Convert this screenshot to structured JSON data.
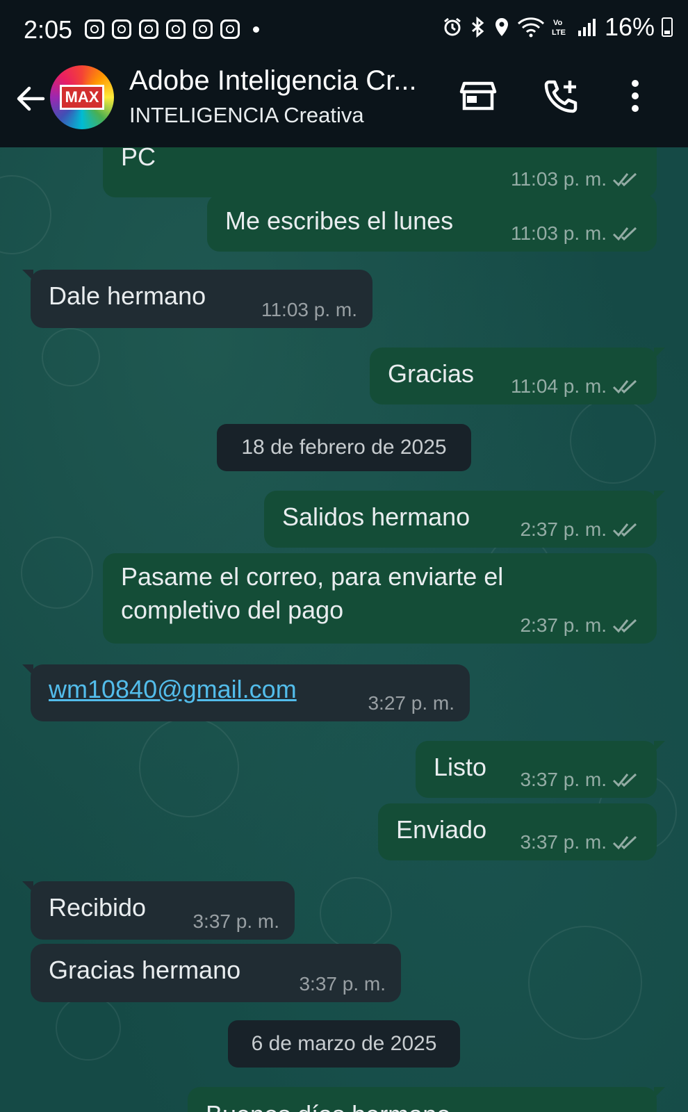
{
  "status_bar": {
    "time": "2:05",
    "battery": "16%"
  },
  "header": {
    "title": "Adobe Inteligencia Cr...",
    "subtitle": "INTELIGENCIA Creativa",
    "avatar_text": "MAX"
  },
  "messages": [
    {
      "text": "PC",
      "time": "11:03 p. m.",
      "dir": "out"
    },
    {
      "text": "Me escribes el lunes",
      "time": "11:03 p. m.",
      "dir": "out"
    },
    {
      "text": "Dale hermano",
      "time": "11:03 p. m.",
      "dir": "in"
    },
    {
      "text": "Gracias",
      "time": "11:04 p. m.",
      "dir": "out"
    },
    {
      "text": "Salidos hermano",
      "time": "2:37 p. m.",
      "dir": "out"
    },
    {
      "text": "Pasame el correo, para enviarte el\ncompletivo del pago",
      "time": "2:37 p. m.",
      "dir": "out"
    },
    {
      "text": "wm10840@gmail.com",
      "time": "3:27 p. m.",
      "dir": "in"
    },
    {
      "text": "Listo",
      "time": "3:37 p. m.",
      "dir": "out"
    },
    {
      "text": "Enviado",
      "time": "3:37 p. m.",
      "dir": "out"
    },
    {
      "text": "Recibido",
      "time": "3:37 p. m.",
      "dir": "in"
    },
    {
      "text": "Gracias hermano",
      "time": "3:37 p. m.",
      "dir": "in"
    },
    {
      "text": "Buenos días hermano",
      "time": "",
      "dir": "out"
    }
  ],
  "date_chips": [
    "18 de febrero de 2025",
    "6 de marzo de 2025"
  ],
  "colors": {
    "outgoing_bubble": "#144d37",
    "incoming_bubble": "#202c33",
    "chat_background": "#154a46",
    "link": "#53bdeb"
  }
}
